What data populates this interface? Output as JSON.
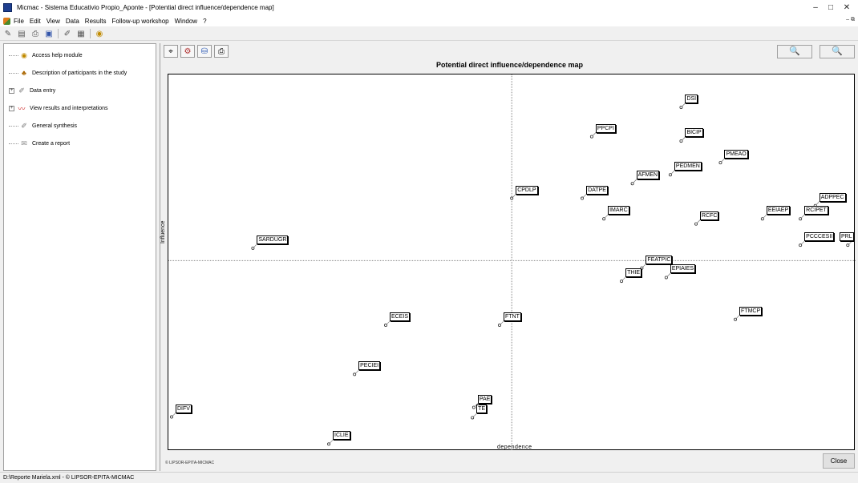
{
  "window": {
    "app_name": "Micmac",
    "separator": "-",
    "study_name": "Sistema Educativio Propio_Aponte",
    "document_title": "[Potential direct influence/dependence map]",
    "minimize_glyph": "–",
    "restore_glyph": "□",
    "close_glyph": "✕",
    "mdi_controls": "– ⧉"
  },
  "menu": {
    "items": [
      "File",
      "Edit",
      "View",
      "Data",
      "Results",
      "Follow-up workshop",
      "Window",
      "?"
    ]
  },
  "toolbar": {
    "icons": [
      "new-icon",
      "open-icon",
      "print-icon",
      "save-icon",
      "data-icon",
      "table-icon",
      "help-icon"
    ]
  },
  "tree": {
    "items": [
      {
        "label": "Access help module",
        "icon": "help-icon",
        "expandable": false
      },
      {
        "label": "Description of participants in the study",
        "icon": "participants-icon",
        "expandable": false
      },
      {
        "label": "Data entry",
        "icon": "data-entry-icon",
        "expandable": true
      },
      {
        "label": "View results and interpretations",
        "icon": "chart-icon",
        "expandable": true
      },
      {
        "label": "General synthesis",
        "icon": "synthesis-icon",
        "expandable": false
      },
      {
        "label": "Create a report",
        "icon": "report-icon",
        "expandable": false
      }
    ]
  },
  "map": {
    "title": "Potential direct influence/dependence map",
    "x_axis_label": "dependence",
    "y_axis_label": "Influence",
    "copyright": "© LIPSOR-EPITA-MICMAC",
    "close_label": "Close",
    "zoom_in_glyph": "🔍",
    "zoom_out_glyph": "🔍",
    "tools": [
      "select-tool-icon",
      "filter-icon",
      "display-icon",
      "print-icon"
    ]
  },
  "chart_data": {
    "type": "scatter",
    "title": "Potential direct influence/dependence map",
    "xlabel": "dependence",
    "ylabel": "Influence",
    "grid": false,
    "crosshair": true,
    "points": [
      {
        "label": "DSI",
        "x": 0.752,
        "y": 0.928
      },
      {
        "label": "PPCPI",
        "x": 0.62,
        "y": 0.848
      },
      {
        "label": "BICIP",
        "x": 0.752,
        "y": 0.836
      },
      {
        "label": "PMEAO",
        "x": 0.81,
        "y": 0.777
      },
      {
        "label": "PEDMEN",
        "x": 0.736,
        "y": 0.744
      },
      {
        "label": "AFMEN",
        "x": 0.68,
        "y": 0.72
      },
      {
        "label": "CPDLP",
        "x": 0.502,
        "y": 0.68
      },
      {
        "label": "DATPE",
        "x": 0.606,
        "y": 0.68
      },
      {
        "label": "IMARC",
        "x": 0.638,
        "y": 0.624
      },
      {
        "label": "RCFC",
        "x": 0.774,
        "y": 0.61
      },
      {
        "label": "EEIAEP",
        "x": 0.872,
        "y": 0.624
      },
      {
        "label": "ADPPEC",
        "x": 0.95,
        "y": 0.66
      },
      {
        "label": "RCIPET",
        "x": 0.928,
        "y": 0.624
      },
      {
        "label": "PRL",
        "x": 0.998,
        "y": 0.552
      },
      {
        "label": "PCCCESII",
        "x": 0.928,
        "y": 0.552
      },
      {
        "label": "SARDUGR",
        "x": 0.12,
        "y": 0.544
      },
      {
        "label": "FEATPIC",
        "x": 0.694,
        "y": 0.49
      },
      {
        "label": "EPIAIES",
        "x": 0.73,
        "y": 0.464
      },
      {
        "label": "THIE",
        "x": 0.664,
        "y": 0.454
      },
      {
        "label": "FTMCP",
        "x": 0.832,
        "y": 0.35
      },
      {
        "label": "ECEIS",
        "x": 0.316,
        "y": 0.334
      },
      {
        "label": "FTNT",
        "x": 0.484,
        "y": 0.334
      },
      {
        "label": "PECIEI",
        "x": 0.27,
        "y": 0.2
      },
      {
        "label": "PAE",
        "x": 0.446,
        "y": 0.11
      },
      {
        "label": "TE",
        "x": 0.444,
        "y": 0.082
      },
      {
        "label": "DIFV",
        "x": 0.0,
        "y": 0.084
      },
      {
        "label": "ICLIE",
        "x": 0.232,
        "y": 0.01
      }
    ],
    "crosshair_x": 0.502,
    "crosshair_y": 0.51
  },
  "status": {
    "text": "D:\\Reporte Mariela.xml  - © LIPSOR-EPITA-MICMAC"
  }
}
